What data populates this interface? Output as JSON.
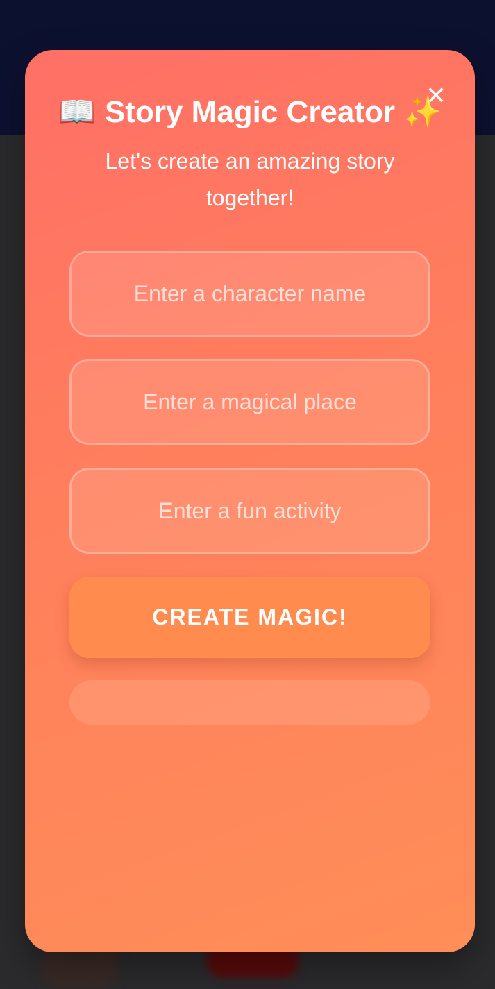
{
  "modal": {
    "close_label": "✕",
    "title_icon": "📖",
    "title": "Story Magic Creator",
    "title_sparkle": "✨",
    "subtitle": "Let's create an amazing story together!",
    "fields": {
      "character_placeholder": "Enter a character name",
      "place_placeholder": "Enter a magical place",
      "activity_placeholder": "Enter a fun activity"
    },
    "create_label": "CREATE MAGIC!",
    "result_text": ""
  },
  "colors": {
    "backdrop": "#2b2b2d",
    "backdrop_top": "#0d1130",
    "modal_gradient_start": "#ff6f66",
    "modal_gradient_end": "#ff8e58",
    "button": "#ff8c4e",
    "text": "#ffffff"
  },
  "icons": {
    "close": "close-icon",
    "title_icon": "open-book-icon",
    "title_sparkle": "sparkles-icon"
  }
}
